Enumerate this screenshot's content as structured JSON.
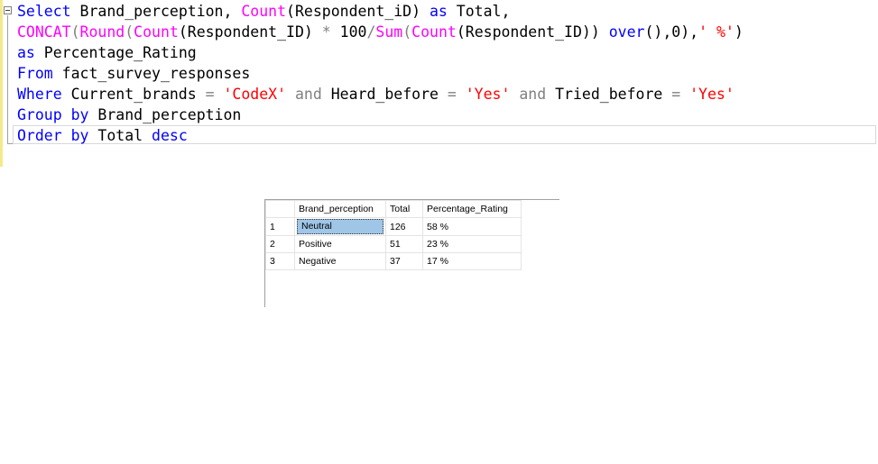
{
  "editor": {
    "lines": [
      [
        {
          "t": "Select",
          "c": "kw"
        },
        {
          "t": " Brand_perception, ",
          "c": "pl"
        },
        {
          "t": "Count",
          "c": "fn"
        },
        {
          "t": "(Respondent_iD) ",
          "c": "pl"
        },
        {
          "t": "as",
          "c": "kw"
        },
        {
          "t": " Total,",
          "c": "pl"
        }
      ],
      [
        {
          "t": "CONCAT",
          "c": "fn"
        },
        {
          "t": "(",
          "c": "gr"
        },
        {
          "t": "Round",
          "c": "fn"
        },
        {
          "t": "(",
          "c": "gr"
        },
        {
          "t": "Count",
          "c": "fn"
        },
        {
          "t": "(Respondent_ID) ",
          "c": "pl"
        },
        {
          "t": "*",
          "c": "gr"
        },
        {
          "t": " 100",
          "c": "pl"
        },
        {
          "t": "/",
          "c": "gr"
        },
        {
          "t": "Sum",
          "c": "fn"
        },
        {
          "t": "(",
          "c": "gr"
        },
        {
          "t": "Count",
          "c": "fn"
        },
        {
          "t": "(Respondent_ID)) ",
          "c": "pl"
        },
        {
          "t": "over",
          "c": "kw"
        },
        {
          "t": "(),0),",
          "c": "pl"
        },
        {
          "t": "' %'",
          "c": "str"
        },
        {
          "t": ")",
          "c": "pl"
        }
      ],
      [
        {
          "t": "as",
          "c": "kw"
        },
        {
          "t": " Percentage_Rating",
          "c": "pl"
        }
      ],
      [
        {
          "t": "From",
          "c": "kw"
        },
        {
          "t": " fact_survey_responses",
          "c": "pl"
        }
      ],
      [
        {
          "t": "Where",
          "c": "kw"
        },
        {
          "t": " Current_brands ",
          "c": "pl"
        },
        {
          "t": "=",
          "c": "gr"
        },
        {
          "t": " ",
          "c": "pl"
        },
        {
          "t": "'CodeX'",
          "c": "str"
        },
        {
          "t": " ",
          "c": "pl"
        },
        {
          "t": "and",
          "c": "gr"
        },
        {
          "t": " Heard_before ",
          "c": "pl"
        },
        {
          "t": "=",
          "c": "gr"
        },
        {
          "t": " ",
          "c": "pl"
        },
        {
          "t": "'Yes'",
          "c": "str"
        },
        {
          "t": " ",
          "c": "pl"
        },
        {
          "t": "and",
          "c": "gr"
        },
        {
          "t": " Tried_before ",
          "c": "pl"
        },
        {
          "t": "=",
          "c": "gr"
        },
        {
          "t": " ",
          "c": "pl"
        },
        {
          "t": "'Yes'",
          "c": "str"
        }
      ],
      [
        {
          "t": "Group",
          "c": "kw"
        },
        {
          "t": " ",
          "c": "pl"
        },
        {
          "t": "by",
          "c": "kw"
        },
        {
          "t": " Brand_perception",
          "c": "pl"
        }
      ],
      [
        {
          "t": "Order",
          "c": "kw"
        },
        {
          "t": " ",
          "c": "pl"
        },
        {
          "t": "by",
          "c": "kw"
        },
        {
          "t": " Total ",
          "c": "pl"
        },
        {
          "t": "desc",
          "c": "kw"
        }
      ]
    ]
  },
  "results": {
    "columns": [
      "",
      "Brand_perception",
      "Total",
      "Percentage_Rating"
    ],
    "rows": [
      {
        "num": "1",
        "brand": "Neutral",
        "total": "126",
        "pct": "58 %"
      },
      {
        "num": "2",
        "brand": "Positive",
        "total": "51",
        "pct": "23 %"
      },
      {
        "num": "3",
        "brand": "Negative",
        "total": "37",
        "pct": "17 %"
      }
    ]
  }
}
